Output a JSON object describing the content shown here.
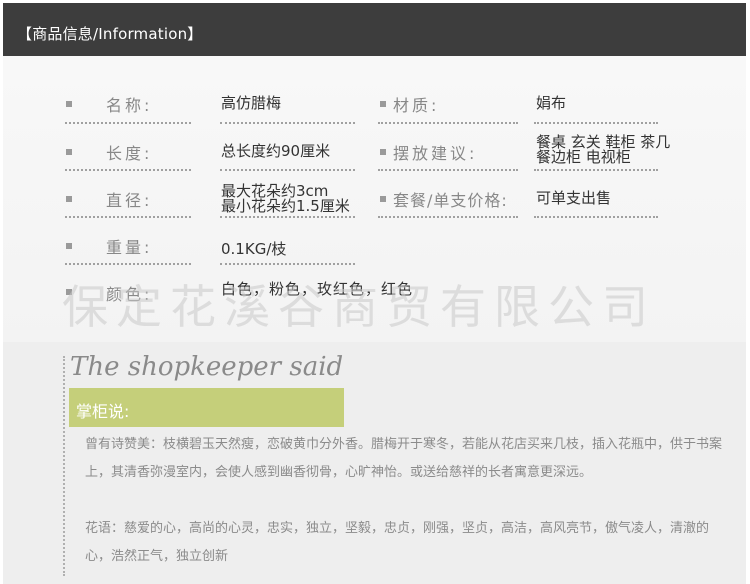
{
  "header": {
    "title": "【商品信息/Information】"
  },
  "rows": [
    {
      "label": "名称:",
      "value": "高仿腊梅",
      "label2": "材质:",
      "value2": "娟布"
    },
    {
      "label": "长度:",
      "value": "总长度约90厘米",
      "label2": "摆放建议:",
      "value2_lines": [
        "餐桌 玄关 鞋柜 茶几",
        "餐边柜 电视柜"
      ]
    },
    {
      "label": "直径:",
      "value_lines": [
        "最大花朵约3cm",
        "最小花朵约1.5厘米"
      ],
      "label2": "套餐/单支价格:",
      "value2": "可单支出售"
    },
    {
      "label": "重量:",
      "value": "0.1KG/枝"
    },
    {
      "label": "颜色:",
      "value": "白色，粉色，玫红色，红色"
    }
  ],
  "watermark": "保定花溪谷商贸有限公司",
  "shopkeeper": {
    "script_title": "The shopkeeper said",
    "badge": "掌柜说:",
    "paragraph1": "曾有诗赞美：枝横碧玉天然瘦，恋破黄巾分外香。腊梅开于寒冬，若能从花店买来几枝，插入花瓶中，供于书案上，其清香弥漫室内，会使人感到幽香彻骨，心旷神怡。或送给慈祥的长者寓意更深远。",
    "paragraph2": "花语：慈爱的心，高尚的心灵，忠实，独立，坚毅，忠贞，刚强，坚贞，高洁，高风亮节，傲气凌人，清澈的心，浩然正气，独立创新"
  },
  "colors": {
    "header_bg": "#3d3d3d",
    "badge_bg": "#c5cf7a"
  }
}
